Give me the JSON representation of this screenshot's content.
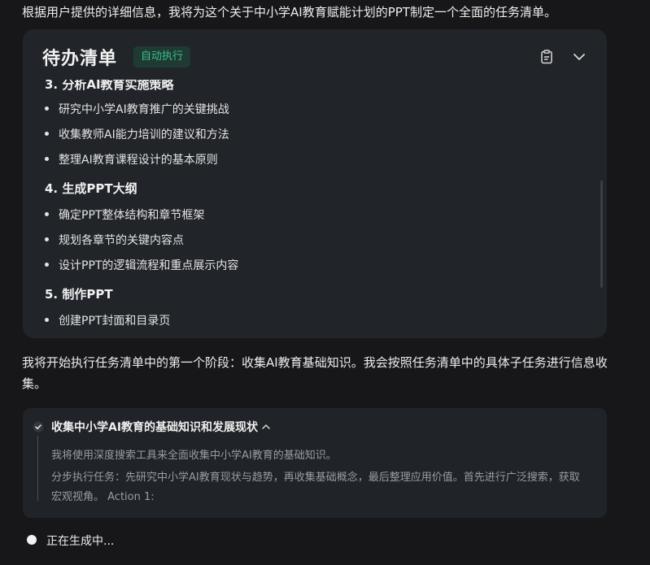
{
  "intro": "根据用户提供的详细信息，我将为这个关于中小学AI教育赋能计划的PPT制定一个全面的任务清单。",
  "todo": {
    "title": "待办清单",
    "badge": "自动执行",
    "clipped_section": "3. 分析AI教育实施策略",
    "sections": [
      {
        "items": [
          "研究中小学AI教育推广的关键挑战",
          "收集教师AI能力培训的建议和方法",
          "整理AI教育课程设计的基本原则"
        ]
      },
      {
        "heading": "4. 生成PPT大纲",
        "items": [
          "确定PPT整体结构和章节框架",
          "规划各章节的关键内容点",
          "设计PPT的逻辑流程和重点展示内容"
        ]
      },
      {
        "heading": "5. 制作PPT",
        "items": [
          "创建PPT封面和目录页"
        ]
      }
    ]
  },
  "message": "我将开始执行任务清单中的第一个阶段：收集AI教育基础知识。我会按照任务清单中的具体子任务进行信息收集。",
  "step": {
    "title": "收集中小学AI教育的基础知识和发展现状",
    "line1": "我将使用深度搜索工具来全面收集中小学AI教育的基础知识。",
    "line2": "分步执行任务：先研究中小学AI教育现状与趋势，再收集基础概念，最后整理应用价值。首先进行广泛搜索，获取宏观视角。 Action 1:"
  },
  "status": "正在生成中..."
}
